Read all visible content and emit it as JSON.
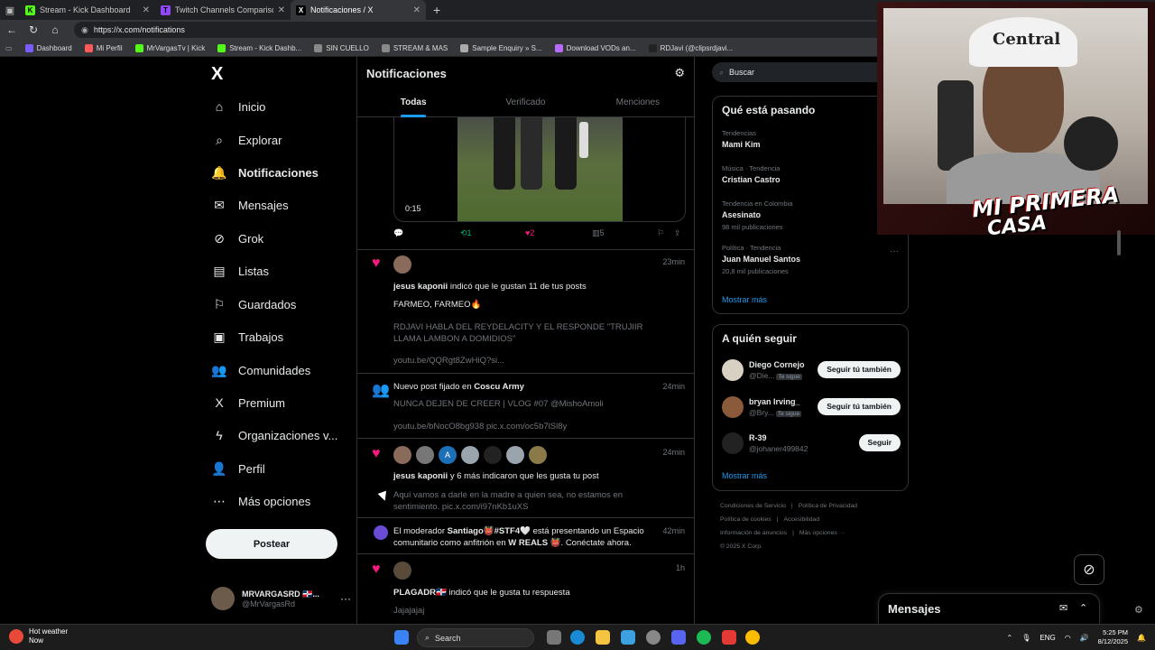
{
  "browser": {
    "tabs": [
      {
        "title": "Stream - Kick Dashboard",
        "fav_color": "#53fc18",
        "fav_glyph": "K",
        "active": false
      },
      {
        "title": "Twitch Channels Comparison - St",
        "fav_color": "#9146ff",
        "fav_glyph": "T",
        "active": false
      },
      {
        "title": "Notificaciones / X",
        "fav_color": "#000000",
        "fav_glyph": "X",
        "active": true
      }
    ],
    "new_tab": "+",
    "url": "https://x.com/notifications",
    "bookmarks": [
      {
        "label": "Dashboard",
        "color": "#7b5cff"
      },
      {
        "label": "Mi Perfil",
        "color": "#ff5a5a"
      },
      {
        "label": "MrVargasTv | Kick",
        "color": "#53fc18"
      },
      {
        "label": "Stream - Kick Dashb...",
        "color": "#53fc18"
      },
      {
        "label": "SIN CUELLO",
        "color": "#888888"
      },
      {
        "label": "STREAM & MAS",
        "color": "#888888"
      },
      {
        "label": "Sample Enquiry » S...",
        "color": "#aaaaaa"
      },
      {
        "label": "Download VODs an...",
        "color": "#b86bff"
      },
      {
        "label": "RDJavi (@clipsrdjavi...",
        "color": "#222222"
      }
    ]
  },
  "nav": {
    "logo": "X",
    "items": [
      {
        "label": "Inicio",
        "icon": "home-icon",
        "glyph": "⌂",
        "bold": false
      },
      {
        "label": "Explorar",
        "icon": "search-icon",
        "glyph": "⌕",
        "bold": false
      },
      {
        "label": "Notificaciones",
        "icon": "bell-icon",
        "glyph": "🔔",
        "bold": true
      },
      {
        "label": "Mensajes",
        "icon": "mail-icon",
        "glyph": "✉",
        "bold": false
      },
      {
        "label": "Grok",
        "icon": "grok-icon",
        "glyph": "⊘",
        "bold": false
      },
      {
        "label": "Listas",
        "icon": "list-icon",
        "glyph": "▤",
        "bold": false
      },
      {
        "label": "Guardados",
        "icon": "bookmark-icon",
        "glyph": "⚐",
        "bold": false
      },
      {
        "label": "Trabajos",
        "icon": "briefcase-icon",
        "glyph": "▣",
        "bold": false
      },
      {
        "label": "Comunidades",
        "icon": "community-icon",
        "glyph": "👥",
        "bold": false
      },
      {
        "label": "Premium",
        "icon": "premium-x-icon",
        "glyph": "X",
        "bold": false
      },
      {
        "label": "Organizaciones v...",
        "icon": "lightning-icon",
        "glyph": "ϟ",
        "bold": false
      },
      {
        "label": "Perfil",
        "icon": "person-icon",
        "glyph": "👤",
        "bold": false
      },
      {
        "label": "Más opciones",
        "icon": "more-options-icon",
        "glyph": "⋯",
        "bold": false
      }
    ],
    "post_button": "Postear",
    "profile": {
      "name": "MRVARGASRD 🇩🇴...",
      "handle": "@MrVargasRd",
      "more": "···"
    }
  },
  "center": {
    "title": "Notificaciones",
    "tabs": [
      "Todas",
      "Verificado",
      "Menciones"
    ],
    "active_tab": "Todas",
    "video": {
      "time": "0:15"
    },
    "actions": {
      "reply": "",
      "retweets": "1",
      "likes": "2",
      "views": "5"
    },
    "notifications": [
      {
        "type": "like",
        "time": "23min",
        "user": "jesus kaponii",
        "text": "indicó que le gustan 11 de tus posts",
        "lines": [
          "FARMEO, FARMEO🔥",
          "RDJAVI HABLA DEL REYDELACITY Y EL RESPONDE \"TRUJIIR LLAMA LAMBON A DOMIDIOS\"",
          "youtu.be/QQRgt8ZwHiQ?si..."
        ]
      },
      {
        "type": "pinned",
        "time": "24min",
        "prefix": "Nuevo post fijado en",
        "user": "Coscu Army",
        "lines": [
          "NUNCA DEJEN DE CREER | VLOG #07 @MishoAmoli",
          "youtu.be/bNocO8bg938 pic.x.com/oc5b7lSl8y"
        ]
      },
      {
        "type": "like",
        "time": "24min",
        "user": "jesus kaponii",
        "text": "y 6 más indicaron que les gusta tu post",
        "avatar_letter": "A",
        "lines": [
          "Aquí vamos a darle en la madre a quien sea, no estamos en sentimiento. pic.x.com/i97nKb1uXS"
        ]
      },
      {
        "type": "space",
        "time": "42min",
        "prefix": "El moderador",
        "user": "Santiago👹#STF4🤍",
        "text": "está presentando un Espacio comunitario como anfitrión en",
        "space": "W REALS 👹",
        "suffix": ". Conéctate ahora."
      },
      {
        "type": "like",
        "time": "1h",
        "user": "PLAGADR🇩🇴",
        "text": "indicó que le gusta tu respuesta",
        "lines": [
          "Jajajajaj"
        ]
      }
    ]
  },
  "right": {
    "search_placeholder": "Buscar",
    "trends_title": "Qué está pasando",
    "trends": [
      {
        "meta": "Tendencias",
        "name": "Mami Kim",
        "count": ""
      },
      {
        "meta": "Música · Tendencia",
        "name": "Cristian Castro",
        "count": ""
      },
      {
        "meta": "Tendencia en Colombia",
        "name": "Asesinato",
        "count": "98 mil publicaciones"
      },
      {
        "meta": "Política · Tendencia",
        "name": "Juan Manuel Santos",
        "count": "20,8 mil publicaciones"
      }
    ],
    "trends_more": "Mostrar más",
    "follow_title": "A quién seguir",
    "follow": [
      {
        "name": "Diego Cornejo",
        "handle": "@Die...",
        "badge": "Te sigue",
        "button": "Seguir tú también",
        "color": "#d9d0c4"
      },
      {
        "name": "bryan Irving_",
        "handle": "@Bry...",
        "badge": "Te sigue",
        "button": "Seguir tú también",
        "color": "#8a5a3a"
      },
      {
        "name": "R-39",
        "handle": "@johaner499842",
        "badge": "",
        "button": "Seguir",
        "color": "#222222"
      }
    ],
    "follow_more": "Mostrar más",
    "footer": [
      [
        "Condiciones de Servicio",
        "Política de Privacidad"
      ],
      [
        "Política de cookies",
        "Accesibilidad"
      ],
      [
        "Información de anuncios",
        "Más opciones ···"
      ],
      [
        "© 2025 X Corp."
      ]
    ]
  },
  "overlay": {
    "cap_text": "Central",
    "label1": "MI PRIMERA",
    "label2": "CASA"
  },
  "messages": {
    "title": "Mensajes"
  },
  "taskbar": {
    "weather_title": "Hot weather",
    "weather_sub": "Now",
    "search": "Search",
    "lang": "ENG",
    "time": "5:25 PM",
    "date": "8/12/2025"
  }
}
